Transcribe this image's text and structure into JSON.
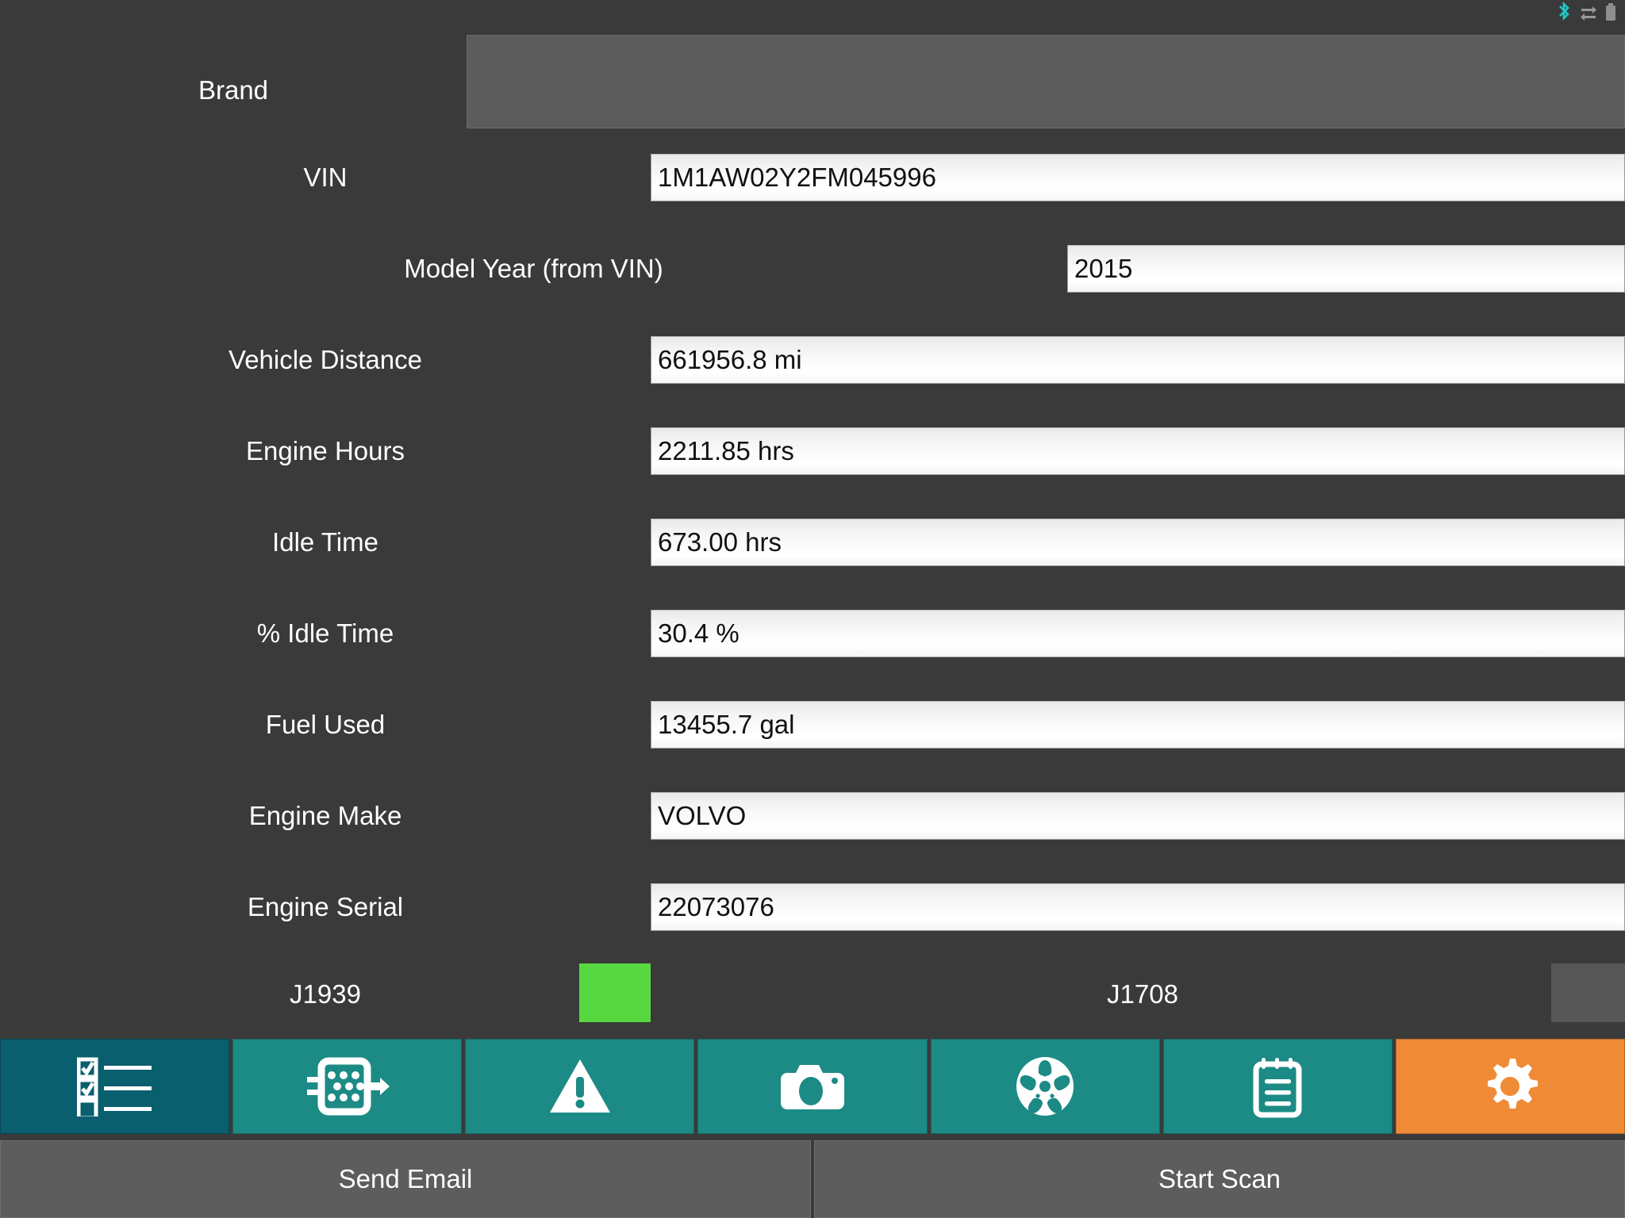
{
  "statusbar": {
    "icons": [
      {
        "name": "bluetooth-icon",
        "color": "#1fc8c8"
      },
      {
        "name": "data-transfer-icon",
        "color": "#9a9a9a"
      },
      {
        "name": "battery-icon",
        "color": "#8e8e8e"
      }
    ]
  },
  "form": {
    "rows": [
      {
        "label": "Brand",
        "value": "",
        "type": "disabled"
      },
      {
        "label": "VIN",
        "value": "1M1AW02Y2FM045996",
        "type": "text"
      },
      {
        "label": "Model Year (from VIN)",
        "value": "2015",
        "type": "text"
      },
      {
        "label": "Vehicle Distance",
        "value": "661956.8 mi",
        "type": "text"
      },
      {
        "label": "Engine Hours",
        "value": "2211.85 hrs",
        "type": "text"
      },
      {
        "label": "Idle Time",
        "value": "673.00 hrs",
        "type": "text"
      },
      {
        "label": "% Idle Time",
        "value": "30.4 %",
        "type": "text"
      },
      {
        "label": "Fuel Used",
        "value": "13455.7 gal",
        "type": "text"
      },
      {
        "label": "Engine Make",
        "value": "VOLVO",
        "type": "text"
      },
      {
        "label": "Engine Serial",
        "value": "22073076",
        "type": "text"
      }
    ]
  },
  "protocols": [
    {
      "label": "J1939",
      "status": "active",
      "color": "#57d841"
    },
    {
      "label": "J1708",
      "status": "inactive",
      "color": "#575757"
    }
  ],
  "tabs": [
    {
      "name": "tab-checklist",
      "icon": "checklist-icon",
      "selected": true,
      "style": "selected"
    },
    {
      "name": "tab-ecu",
      "icon": "ecu-connector-icon",
      "selected": false,
      "style": "normal"
    },
    {
      "name": "tab-faults",
      "icon": "warning-triangle-icon",
      "selected": false,
      "style": "normal"
    },
    {
      "name": "tab-camera",
      "icon": "camera-icon",
      "selected": false,
      "style": "normal"
    },
    {
      "name": "tab-wheels",
      "icon": "wheel-icon",
      "selected": false,
      "style": "normal"
    },
    {
      "name": "tab-notes",
      "icon": "notepad-icon",
      "selected": false,
      "style": "normal"
    },
    {
      "name": "tab-settings",
      "icon": "gear-icon",
      "selected": false,
      "style": "settings"
    }
  ],
  "buttons": {
    "send_email": "Send Email",
    "start_scan": "Start Scan"
  },
  "colors": {
    "background": "#3a3a3a",
    "tab_teal": "#1c8a85",
    "tab_selected": "#0a5f6e",
    "tab_orange": "#ef8b36",
    "led_on": "#57d841",
    "led_off": "#575757",
    "button_gray": "#5d5d5d",
    "disabled_field": "#5c5c5c"
  }
}
